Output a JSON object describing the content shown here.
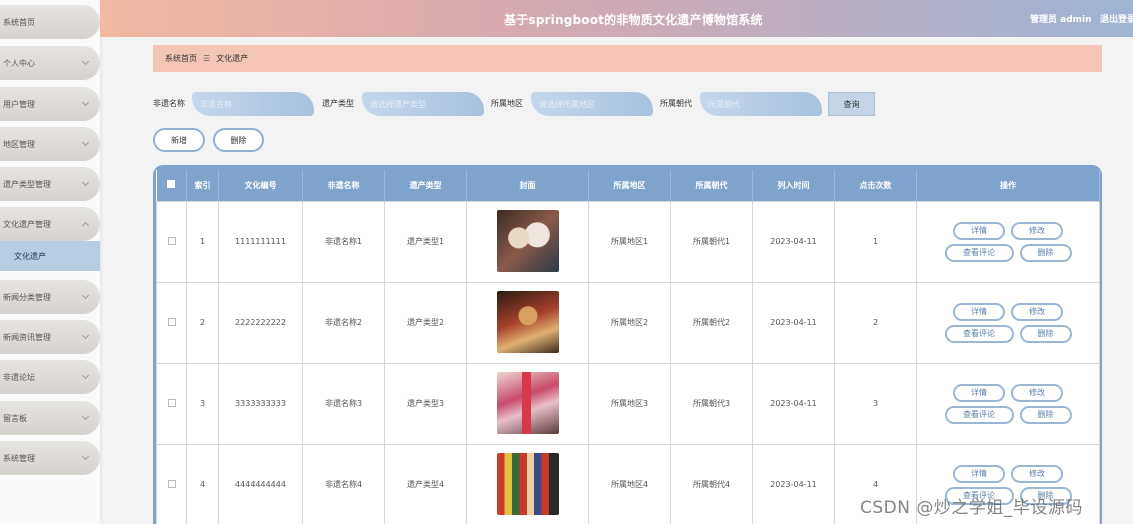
{
  "header": {
    "title": "基于springboot的非物质文化遗产博物馆系统",
    "user": "管理员 admin",
    "logout": "退出登录"
  },
  "sidebar": {
    "items": [
      {
        "label": "系统首页",
        "arrow": false
      },
      {
        "label": "个人中心",
        "arrow": true
      },
      {
        "label": "用户管理",
        "arrow": true
      },
      {
        "label": "地区管理",
        "arrow": true
      },
      {
        "label": "遗产类型管理",
        "arrow": true
      },
      {
        "label": "文化遗产管理",
        "arrow": true,
        "expanded": true
      },
      {
        "label": "新闻分类管理",
        "arrow": true
      },
      {
        "label": "新闻资讯管理",
        "arrow": true
      },
      {
        "label": "非遗论坛",
        "arrow": true
      },
      {
        "label": "留言板",
        "arrow": true
      },
      {
        "label": "系统管理",
        "arrow": true
      }
    ],
    "active_sub": "文化遗产"
  },
  "breadcrumb": {
    "home": "系统首页",
    "separator": "☰",
    "current": "文化遗产"
  },
  "search": {
    "name_label": "非遗名称",
    "name_placeholder": "非遗名称",
    "type_label": "遗产类型",
    "type_placeholder": "请选择遗产类型",
    "region_label": "所属地区",
    "region_placeholder": "请选择所属地区",
    "dynasty_label": "所属朝代",
    "dynasty_placeholder": "所属朝代",
    "query_btn": "查询"
  },
  "actions": {
    "add": "新增",
    "delete": "删除"
  },
  "table": {
    "headers": [
      "索引",
      "文化编号",
      "非遗名称",
      "遗产类型",
      "封面",
      "所属地区",
      "所属朝代",
      "列入时间",
      "点击次数",
      "操作"
    ],
    "rows": [
      {
        "index": "1",
        "code": "1111111111",
        "name": "非遗名称1",
        "type": "遗产类型1",
        "region": "所属地区1",
        "dynasty": "所属朝代1",
        "date": "2023-04-11",
        "clicks": "1"
      },
      {
        "index": "2",
        "code": "2222222222",
        "name": "非遗名称2",
        "type": "遗产类型2",
        "region": "所属地区2",
        "dynasty": "所属朝代2",
        "date": "2023-04-11",
        "clicks": "2"
      },
      {
        "index": "3",
        "code": "3333333333",
        "name": "非遗名称3",
        "type": "遗产类型3",
        "region": "所属地区3",
        "dynasty": "所属朝代3",
        "date": "2023-04-11",
        "clicks": "3"
      },
      {
        "index": "4",
        "code": "4444444444",
        "name": "非遗名称4",
        "type": "遗产类型4",
        "region": "所属地区4",
        "dynasty": "所属朝代4",
        "date": "2023-04-11",
        "clicks": "4"
      }
    ],
    "op_labels": {
      "detail": "详情",
      "edit": "修改",
      "comments": "查看评论",
      "delete": "删除"
    }
  },
  "watermark": "CSDN @炒之学姐_毕设源码",
  "colors": {
    "accent_blue": "#7ea3cc",
    "header_start": "#f2b8a2",
    "breadcrumb_bg": "#f4c4b6",
    "sidebar_active": "#b7cde3"
  }
}
